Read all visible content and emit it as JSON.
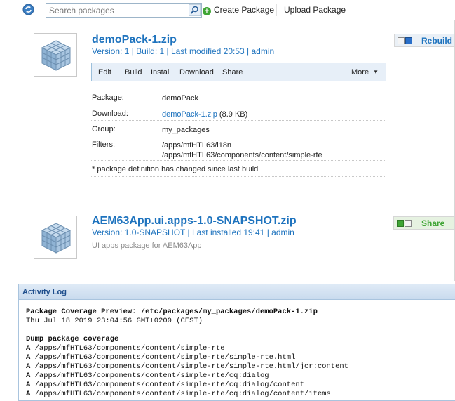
{
  "toolbar": {
    "search_placeholder": "Search packages",
    "create_label": "Create Package",
    "upload_label": "Upload Package"
  },
  "packages": [
    {
      "title": "demoPack-1.zip",
      "meta": "Version: 1 | Build: 1 | Last modified 20:53 | admin",
      "actions": [
        "Edit",
        "Build",
        "Install",
        "Download",
        "Share"
      ],
      "more_label": "More",
      "side_button": "Rebuild",
      "details": {
        "package_key": "Package:",
        "package_value": "demoPack",
        "download_key": "Download:",
        "download_link": "demoPack-1.zip",
        "download_size": " (8.9 KB)",
        "group_key": "Group:",
        "group_value": "my_packages",
        "filters_key": "Filters:",
        "filters": [
          "/apps/mfHTL63/i18n",
          "/apps/mfHTL63/components/content/simple-rte"
        ],
        "note": "* package definition has changed since last build"
      }
    },
    {
      "title": "AEM63App.ui.apps-1.0-SNAPSHOT.zip",
      "meta": "Version: 1.0-SNAPSHOT | Last installed 19:41 | admin",
      "description": "UI apps package for AEM63App",
      "side_button": "Share"
    }
  ],
  "activity_log": {
    "title": "Activity Log",
    "preview_line": "Package Coverage Preview: /etc/packages/my_packages/demoPack-1.zip",
    "timestamp": "Thu Jul 18 2019 23:04:56 GMT+0200 (CEST)",
    "section": "Dump package coverage",
    "entries": [
      {
        "op": "A",
        "path": " /apps/mfHTL63/components/content/simple-rte"
      },
      {
        "op": "A",
        "path": " /apps/mfHTL63/components/content/simple-rte/simple-rte.html"
      },
      {
        "op": "A",
        "path": " /apps/mfHTL63/components/content/simple-rte/simple-rte.html/jcr:content"
      },
      {
        "op": "A",
        "path": " /apps/mfHTL63/components/content/simple-rte/cq:dialog"
      },
      {
        "op": "A",
        "path": " /apps/mfHTL63/components/content/simple-rte/cq:dialog/content"
      },
      {
        "op": "A",
        "path": " /apps/mfHTL63/components/content/simple-rte/cq:dialog/content/items"
      }
    ]
  },
  "colors": {
    "link_blue": "#1e73be",
    "action_bar_bg": "#e7eff8",
    "create_green": "#3fa535",
    "status_blue": "#2a6fc9",
    "status_green": "#3fa535"
  },
  "icons": {
    "refresh": "refresh-icon",
    "search": "search-icon",
    "create": "plus-circle-icon",
    "package": "package-cube-icon",
    "more": "caret-down-icon"
  }
}
